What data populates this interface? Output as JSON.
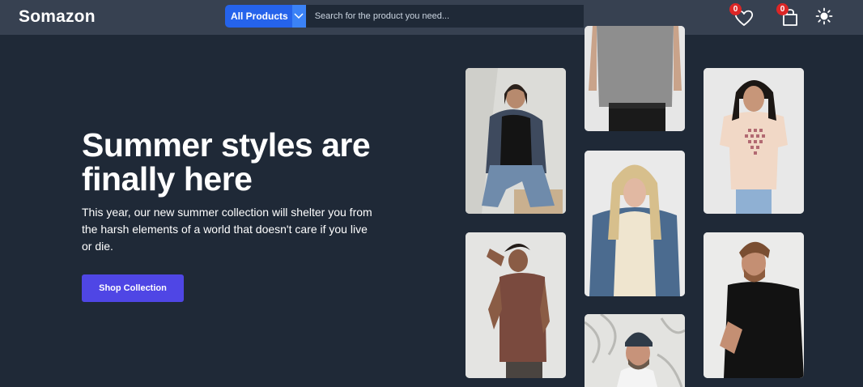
{
  "header": {
    "brand": "Somazon",
    "category": "All Products",
    "search_placeholder": "Search for the product you need...",
    "wishlist_count": "0",
    "cart_count": "0"
  },
  "hero": {
    "title": "Summer styles are finally here",
    "subtitle": "This year, our new summer collection will shelter you from the harsh elements of a world that doesn't care if you live or die.",
    "cta": "Shop Collection"
  },
  "colors": {
    "background": "#1f2937",
    "navbar": "#374151",
    "accent": "#4f46e5",
    "category_button": "#2563eb",
    "badge": "#dc2626"
  },
  "icons": {
    "wishlist": "heart-icon",
    "cart": "shopping-bag-icon",
    "theme": "sun-icon",
    "category_toggle": "chevron-down-icon"
  }
}
